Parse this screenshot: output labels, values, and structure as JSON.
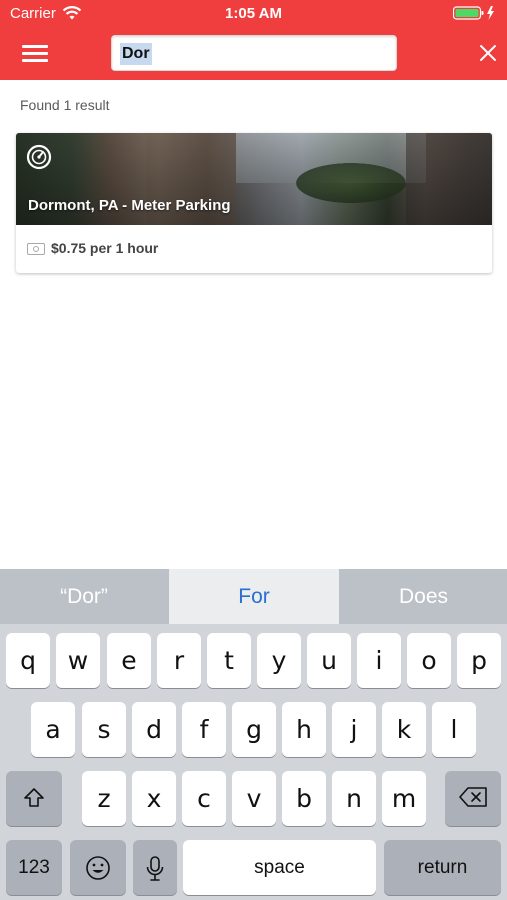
{
  "status_bar": {
    "carrier": "Carrier",
    "time": "1:05 AM"
  },
  "nav": {
    "search_value": "Dor",
    "menu_icon": "hamburger-menu-icon",
    "close_icon": "close-icon"
  },
  "results": {
    "count_text": "Found 1 result",
    "items": [
      {
        "title": "Dormont, PA - Meter Parking",
        "rate": "$0.75 per 1 hour",
        "icon": "parking-meter-icon",
        "rate_icon": "cash-icon"
      }
    ]
  },
  "keyboard": {
    "suggestions": [
      "“Dor”",
      "For",
      "Does"
    ],
    "row1": [
      "q",
      "w",
      "e",
      "r",
      "t",
      "y",
      "u",
      "i",
      "o",
      "p"
    ],
    "row2": [
      "a",
      "s",
      "d",
      "f",
      "g",
      "h",
      "j",
      "k",
      "l"
    ],
    "row3": [
      "z",
      "x",
      "c",
      "v",
      "b",
      "n",
      "m"
    ],
    "numbers_label": "123",
    "space_label": "space",
    "return_label": "return"
  },
  "colors": {
    "brand_red": "#f03e3e",
    "suggestion_blue": "#2a6fd1",
    "keyboard_bg": "#d1d4d9"
  }
}
